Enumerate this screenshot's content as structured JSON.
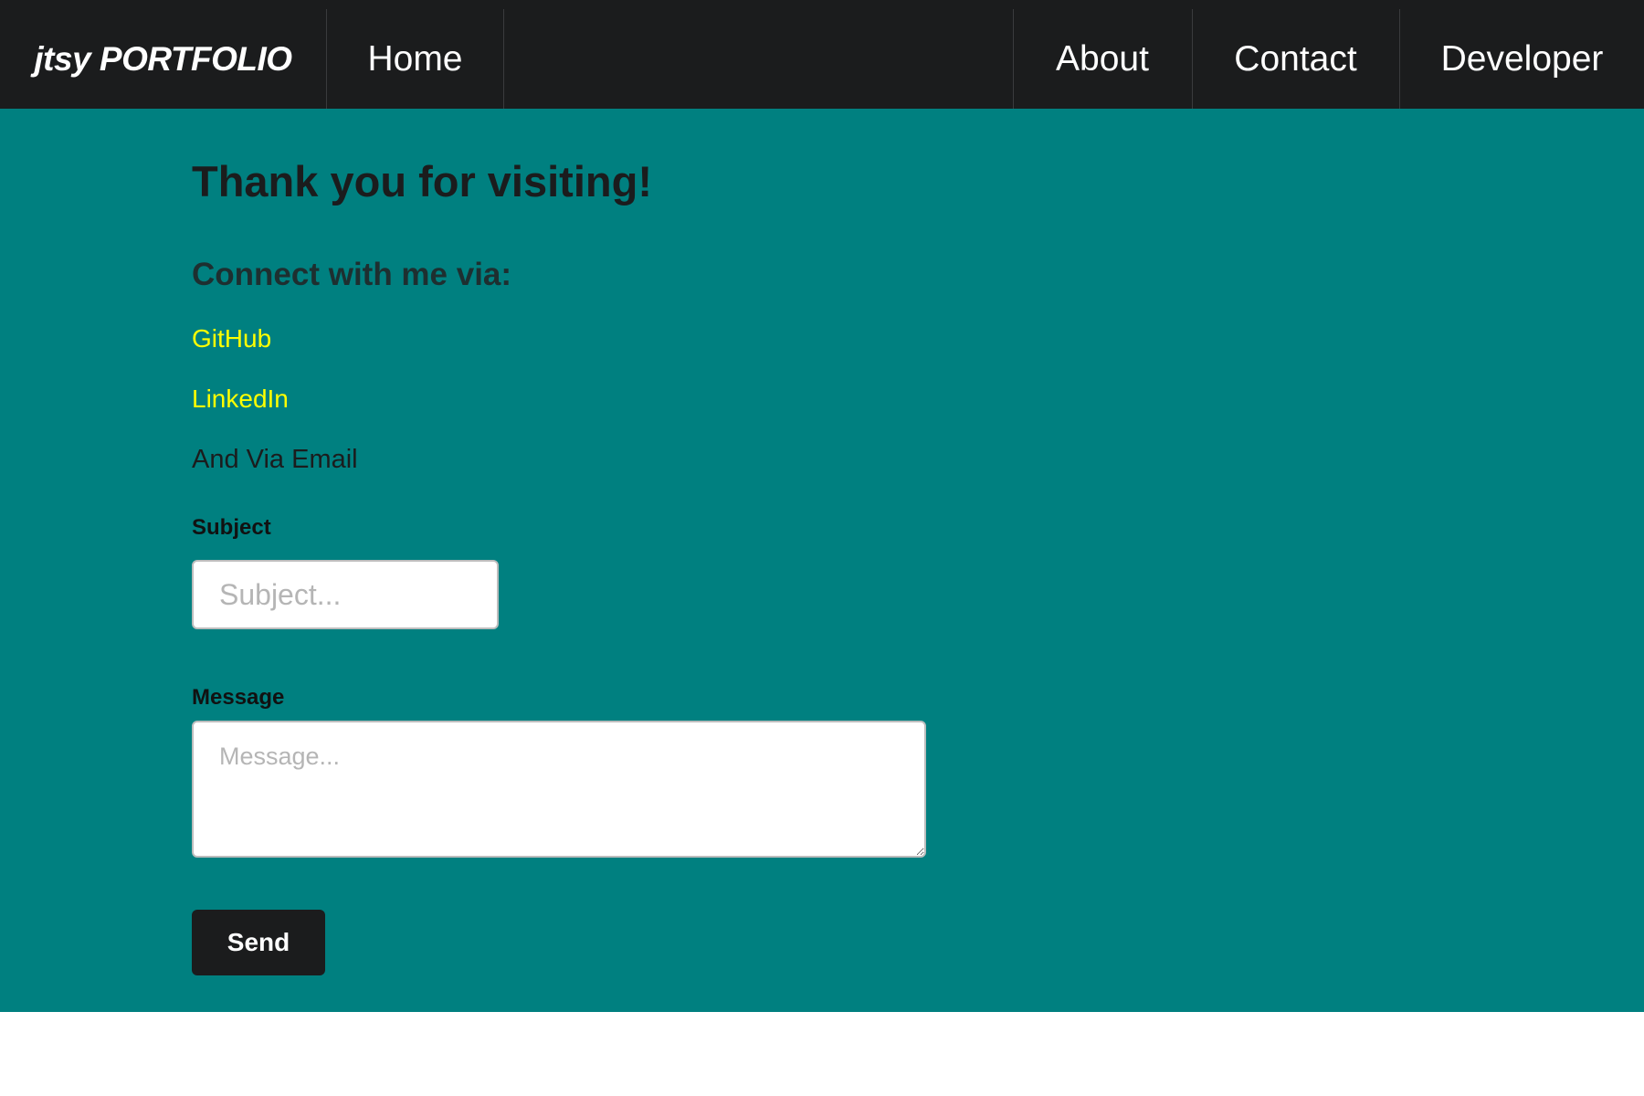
{
  "navbar": {
    "brand": "jtsy PORTFOLIO",
    "home": "Home",
    "about": "About",
    "contact": "Contact",
    "developer": "Developer"
  },
  "main": {
    "title": "Thank you for visiting!",
    "subtitle": "Connect with me via:",
    "links": {
      "github": "GitHub",
      "linkedin": "LinkedIn"
    },
    "email_text": "And Via Email",
    "form": {
      "subject_label": "Subject",
      "subject_placeholder": "Subject...",
      "subject_value": "",
      "message_label": "Message",
      "message_placeholder": "Message...",
      "message_value": "",
      "send_label": "Send"
    }
  },
  "colors": {
    "navbar_bg": "#1b1c1d",
    "main_bg": "#008080",
    "link": "#ffff00",
    "button_bg": "#1b1c1d"
  }
}
